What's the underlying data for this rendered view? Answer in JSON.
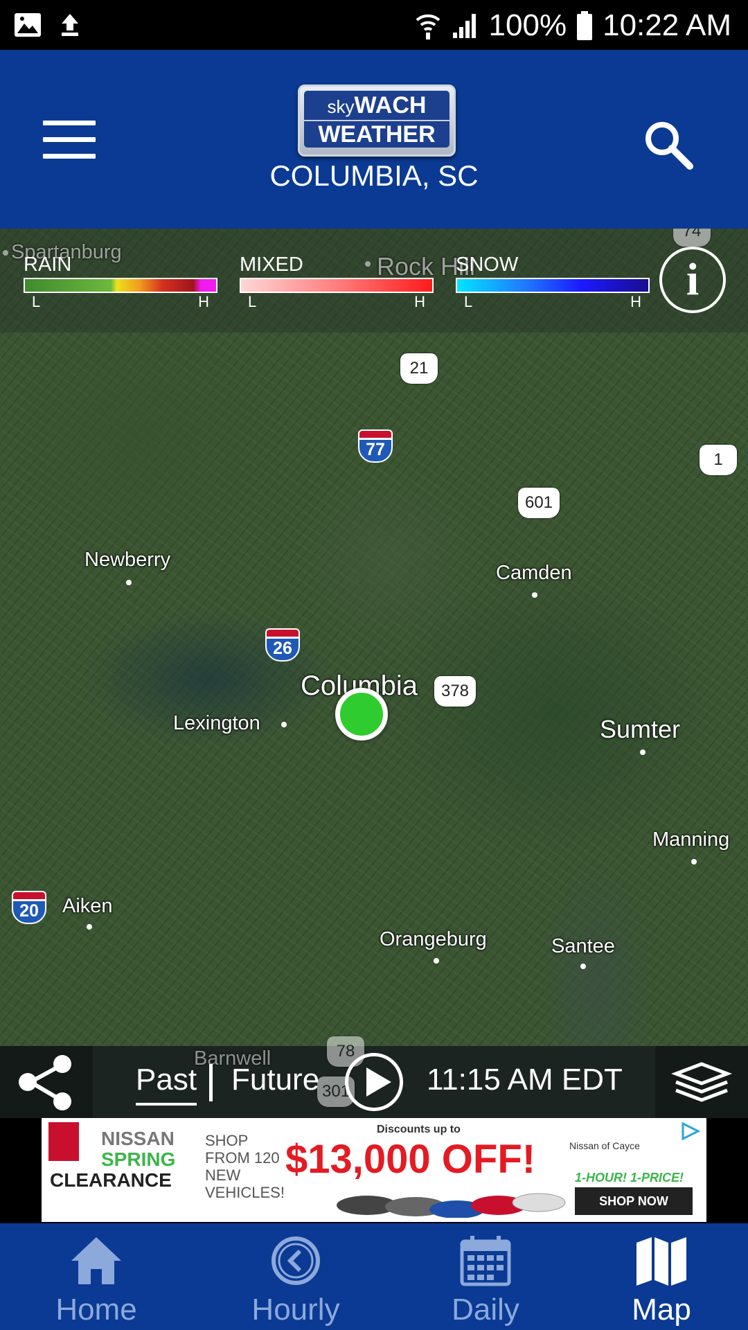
{
  "status_bar": {
    "battery": "100%",
    "time": "10:22 AM"
  },
  "header": {
    "logo": {
      "line1_sky": "sky",
      "line1_wach": "WACH",
      "line2": "WEATHER"
    },
    "location": "COLUMBIA, SC"
  },
  "legend": {
    "groups": [
      {
        "title": "RAIN",
        "low": "L",
        "high": "H"
      },
      {
        "title": "MIXED",
        "low": "L",
        "high": "H"
      },
      {
        "title": "SNOW",
        "low": "L",
        "high": "H"
      }
    ],
    "colors": {
      "rain": [
        "#3f8a2d",
        "#6db83e",
        "#e9e21c",
        "#f29b1c",
        "#d5301e",
        "#a0141b",
        "#f21af0"
      ],
      "mixed": [
        "#ffd6d6",
        "#ff7d7d",
        "#ff1a1a"
      ],
      "snow": [
        "#00e5ff",
        "#1e7bff",
        "#1a1aff",
        "#1a0d8f"
      ]
    }
  },
  "map": {
    "places": [
      {
        "name": "Spartanburg"
      },
      {
        "name": "Rock Hill"
      },
      {
        "name": "Newberry"
      },
      {
        "name": "Camden"
      },
      {
        "name": "Columbia"
      },
      {
        "name": "Lexington"
      },
      {
        "name": "Sumter"
      },
      {
        "name": "Manning"
      },
      {
        "name": "Aiken"
      },
      {
        "name": "Orangeburg"
      },
      {
        "name": "Santee"
      },
      {
        "name": "Barnwell"
      }
    ],
    "routes": {
      "us": [
        "74",
        "21",
        "1",
        "601",
        "378",
        "78",
        "301"
      ],
      "interstate": [
        "77",
        "26",
        "20"
      ]
    }
  },
  "timeline": {
    "past": "Past",
    "future": "Future",
    "time": "11:15 AM EDT"
  },
  "ad": {
    "brand1": "NISSAN",
    "brand2": "SPRING",
    "brand3": "CLEARANCE",
    "shop": "SHOP FROM 120 NEW VEHICLES!",
    "discount_intro": "Discounts up to",
    "price": "$13,000 OFF!",
    "dealer": "Nissan of Cayce",
    "tagline": "1-HOUR! 1-PRICE!",
    "cta": "SHOP NOW"
  },
  "bottom_nav": [
    {
      "label": "Home",
      "icon": "home-icon"
    },
    {
      "label": "Hourly",
      "icon": "clock-icon"
    },
    {
      "label": "Daily",
      "icon": "calendar-icon"
    },
    {
      "label": "Map",
      "icon": "map-icon",
      "active": true
    }
  ]
}
